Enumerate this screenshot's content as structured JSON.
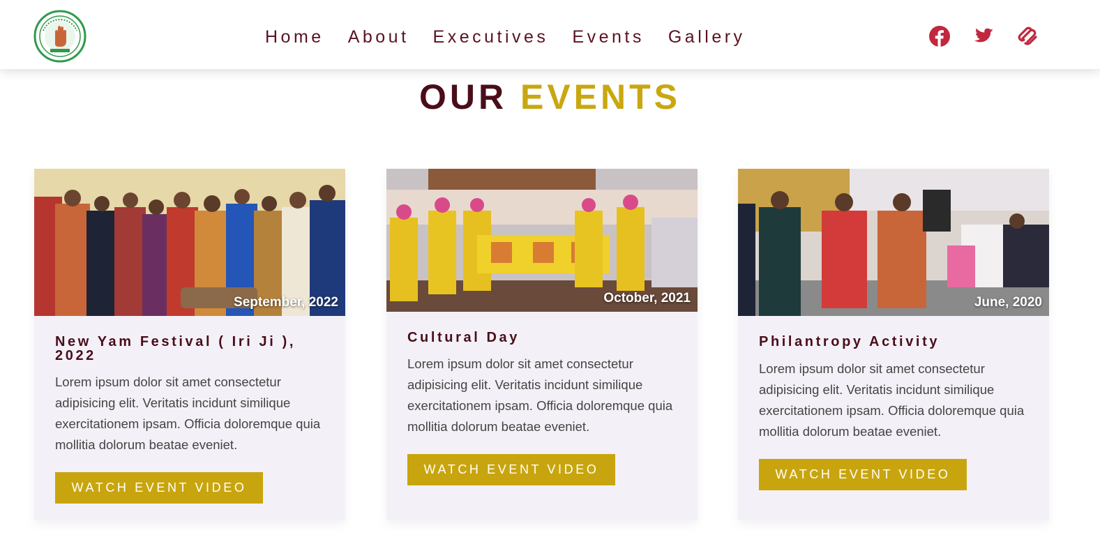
{
  "nav": {
    "items": [
      "Home",
      "About",
      "Executives",
      "Events",
      "Gallery"
    ]
  },
  "social": {
    "icons": [
      "facebook-icon",
      "twitter-icon",
      "squarespace-icon"
    ],
    "color": "#c0283e"
  },
  "heading": {
    "word1": "OUR",
    "word2": "EVENTS"
  },
  "colors": {
    "maroon": "#4a0d19",
    "gold": "#c8a50e",
    "card_bg": "#f3f1f7"
  },
  "events": [
    {
      "date": "September, 2022",
      "title": "New Yam Festival ( Iri Ji ), 2022",
      "description": "Lorem ipsum dolor sit amet consectetur adipisicing elit. Veritatis incidunt similique exercitationem ipsam. Officia doloremque quia mollitia dolorum beatae eveniet.",
      "button": "WATCH EVENT VIDEO"
    },
    {
      "date": "October, 2021",
      "title": "Cultural Day",
      "description": "Lorem ipsum dolor sit amet consectetur adipisicing elit. Veritatis incidunt similique exercitationem ipsam. Officia doloremque quia mollitia dolorum beatae eveniet.",
      "button": "WATCH EVENT VIDEO"
    },
    {
      "date": "June, 2020",
      "title": "Philantropy Activity",
      "description": "Lorem ipsum dolor sit amet consectetur adipisicing elit. Veritatis incidunt similique exercitationem ipsam. Officia doloremque quia mollitia dolorum beatae eveniet.",
      "button": "WATCH EVENT VIDEO"
    }
  ]
}
